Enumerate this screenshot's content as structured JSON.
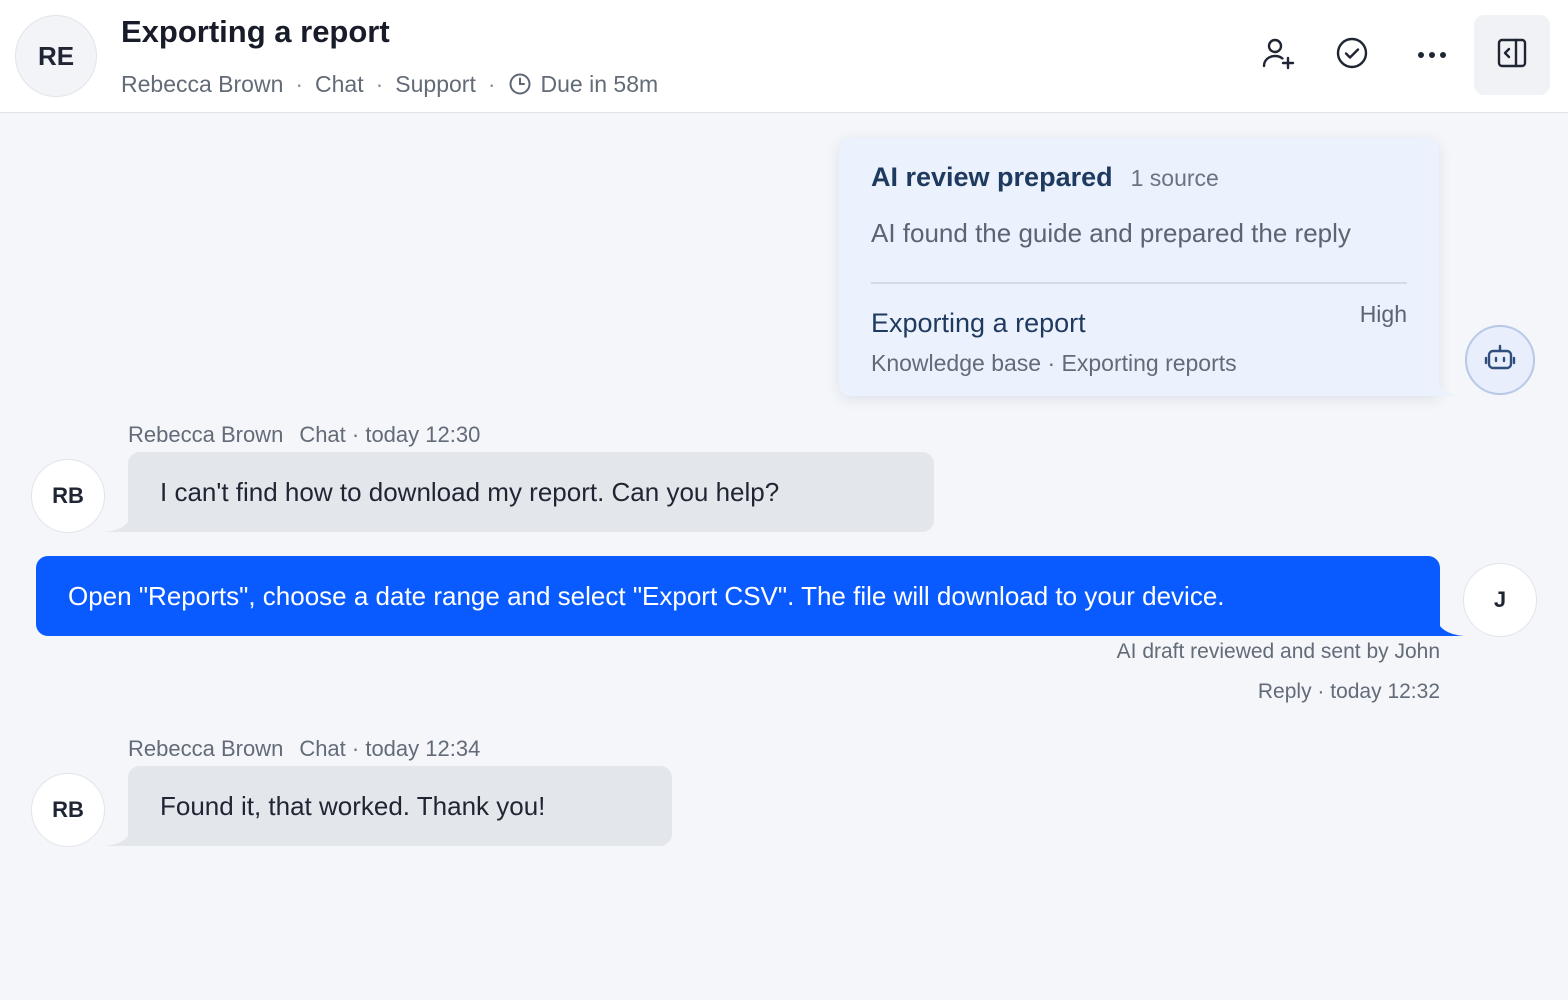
{
  "header": {
    "avatar_initials": "RE",
    "title": "Exporting a report",
    "contact_name": "Rebecca Brown",
    "separator": "·",
    "channel": "Chat",
    "team": "Support",
    "due": "Due in 58m",
    "actions": [
      {
        "name": "assign",
        "icon": "user-plus-icon"
      },
      {
        "name": "resolve",
        "icon": "check-circle-icon"
      },
      {
        "name": "more",
        "icon": "more-horizontal-icon"
      },
      {
        "name": "toggle-panel",
        "icon": "collapse-panel-icon"
      }
    ]
  },
  "ai_review": {
    "title": "AI review prepared",
    "source_count": "1 source",
    "description": "AI found the guide and prepared the reply",
    "source": {
      "title": "Exporting a report",
      "priority": "High",
      "path": "Knowledge base · Exporting reports"
    },
    "bot_icon": "robot-icon"
  },
  "messages": [
    {
      "author": "Rebecca Brown",
      "meta": "Chat · today 12:30",
      "initials": "RB",
      "text": "I can't find how to download my report. Can you help?"
    },
    {
      "initials": "J",
      "text": "Open \"Reports\", choose a date range and select \"Export CSV\". The file will download to your device.",
      "note": "AI draft reviewed and sent by John",
      "meta": "Reply · today 12:32"
    },
    {
      "author": "Rebecca Brown",
      "meta": "Chat · today 12:34",
      "initials": "RB",
      "text": "Found it, that worked. Thank you!"
    }
  ],
  "colors": {
    "accent": "#0a5bff",
    "incoming_bubble": "#e3e6ea",
    "ai_card": "#ebf1fd",
    "background": "#f4f6f9"
  }
}
